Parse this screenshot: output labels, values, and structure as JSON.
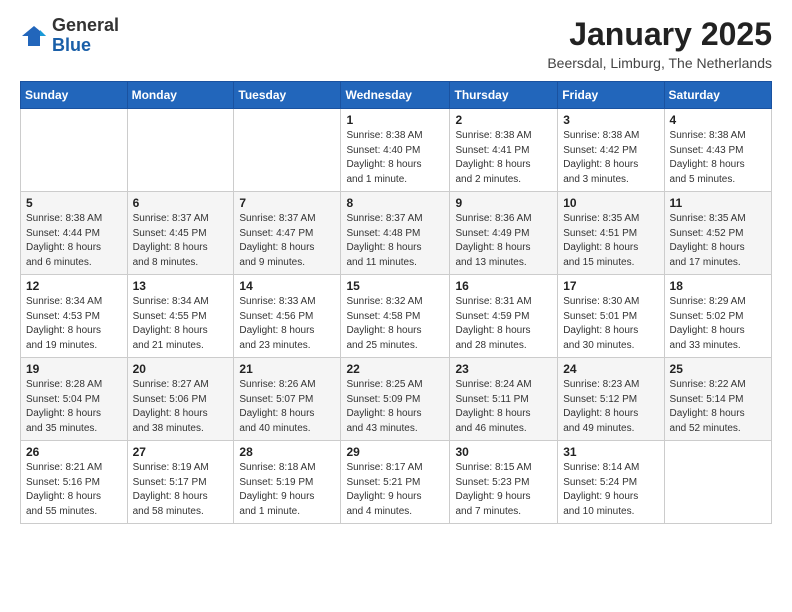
{
  "header": {
    "logo_general": "General",
    "logo_blue": "Blue",
    "month": "January 2025",
    "location": "Beersdal, Limburg, The Netherlands"
  },
  "weekdays": [
    "Sunday",
    "Monday",
    "Tuesday",
    "Wednesday",
    "Thursday",
    "Friday",
    "Saturday"
  ],
  "weeks": [
    [
      {
        "day": "",
        "info": ""
      },
      {
        "day": "",
        "info": ""
      },
      {
        "day": "",
        "info": ""
      },
      {
        "day": "1",
        "info": "Sunrise: 8:38 AM\nSunset: 4:40 PM\nDaylight: 8 hours\nand 1 minute."
      },
      {
        "day": "2",
        "info": "Sunrise: 8:38 AM\nSunset: 4:41 PM\nDaylight: 8 hours\nand 2 minutes."
      },
      {
        "day": "3",
        "info": "Sunrise: 8:38 AM\nSunset: 4:42 PM\nDaylight: 8 hours\nand 3 minutes."
      },
      {
        "day": "4",
        "info": "Sunrise: 8:38 AM\nSunset: 4:43 PM\nDaylight: 8 hours\nand 5 minutes."
      }
    ],
    [
      {
        "day": "5",
        "info": "Sunrise: 8:38 AM\nSunset: 4:44 PM\nDaylight: 8 hours\nand 6 minutes."
      },
      {
        "day": "6",
        "info": "Sunrise: 8:37 AM\nSunset: 4:45 PM\nDaylight: 8 hours\nand 8 minutes."
      },
      {
        "day": "7",
        "info": "Sunrise: 8:37 AM\nSunset: 4:47 PM\nDaylight: 8 hours\nand 9 minutes."
      },
      {
        "day": "8",
        "info": "Sunrise: 8:37 AM\nSunset: 4:48 PM\nDaylight: 8 hours\nand 11 minutes."
      },
      {
        "day": "9",
        "info": "Sunrise: 8:36 AM\nSunset: 4:49 PM\nDaylight: 8 hours\nand 13 minutes."
      },
      {
        "day": "10",
        "info": "Sunrise: 8:35 AM\nSunset: 4:51 PM\nDaylight: 8 hours\nand 15 minutes."
      },
      {
        "day": "11",
        "info": "Sunrise: 8:35 AM\nSunset: 4:52 PM\nDaylight: 8 hours\nand 17 minutes."
      }
    ],
    [
      {
        "day": "12",
        "info": "Sunrise: 8:34 AM\nSunset: 4:53 PM\nDaylight: 8 hours\nand 19 minutes."
      },
      {
        "day": "13",
        "info": "Sunrise: 8:34 AM\nSunset: 4:55 PM\nDaylight: 8 hours\nand 21 minutes."
      },
      {
        "day": "14",
        "info": "Sunrise: 8:33 AM\nSunset: 4:56 PM\nDaylight: 8 hours\nand 23 minutes."
      },
      {
        "day": "15",
        "info": "Sunrise: 8:32 AM\nSunset: 4:58 PM\nDaylight: 8 hours\nand 25 minutes."
      },
      {
        "day": "16",
        "info": "Sunrise: 8:31 AM\nSunset: 4:59 PM\nDaylight: 8 hours\nand 28 minutes."
      },
      {
        "day": "17",
        "info": "Sunrise: 8:30 AM\nSunset: 5:01 PM\nDaylight: 8 hours\nand 30 minutes."
      },
      {
        "day": "18",
        "info": "Sunrise: 8:29 AM\nSunset: 5:02 PM\nDaylight: 8 hours\nand 33 minutes."
      }
    ],
    [
      {
        "day": "19",
        "info": "Sunrise: 8:28 AM\nSunset: 5:04 PM\nDaylight: 8 hours\nand 35 minutes."
      },
      {
        "day": "20",
        "info": "Sunrise: 8:27 AM\nSunset: 5:06 PM\nDaylight: 8 hours\nand 38 minutes."
      },
      {
        "day": "21",
        "info": "Sunrise: 8:26 AM\nSunset: 5:07 PM\nDaylight: 8 hours\nand 40 minutes."
      },
      {
        "day": "22",
        "info": "Sunrise: 8:25 AM\nSunset: 5:09 PM\nDaylight: 8 hours\nand 43 minutes."
      },
      {
        "day": "23",
        "info": "Sunrise: 8:24 AM\nSunset: 5:11 PM\nDaylight: 8 hours\nand 46 minutes."
      },
      {
        "day": "24",
        "info": "Sunrise: 8:23 AM\nSunset: 5:12 PM\nDaylight: 8 hours\nand 49 minutes."
      },
      {
        "day": "25",
        "info": "Sunrise: 8:22 AM\nSunset: 5:14 PM\nDaylight: 8 hours\nand 52 minutes."
      }
    ],
    [
      {
        "day": "26",
        "info": "Sunrise: 8:21 AM\nSunset: 5:16 PM\nDaylight: 8 hours\nand 55 minutes."
      },
      {
        "day": "27",
        "info": "Sunrise: 8:19 AM\nSunset: 5:17 PM\nDaylight: 8 hours\nand 58 minutes."
      },
      {
        "day": "28",
        "info": "Sunrise: 8:18 AM\nSunset: 5:19 PM\nDaylight: 9 hours\nand 1 minute."
      },
      {
        "day": "29",
        "info": "Sunrise: 8:17 AM\nSunset: 5:21 PM\nDaylight: 9 hours\nand 4 minutes."
      },
      {
        "day": "30",
        "info": "Sunrise: 8:15 AM\nSunset: 5:23 PM\nDaylight: 9 hours\nand 7 minutes."
      },
      {
        "day": "31",
        "info": "Sunrise: 8:14 AM\nSunset: 5:24 PM\nDaylight: 9 hours\nand 10 minutes."
      },
      {
        "day": "",
        "info": ""
      }
    ]
  ]
}
